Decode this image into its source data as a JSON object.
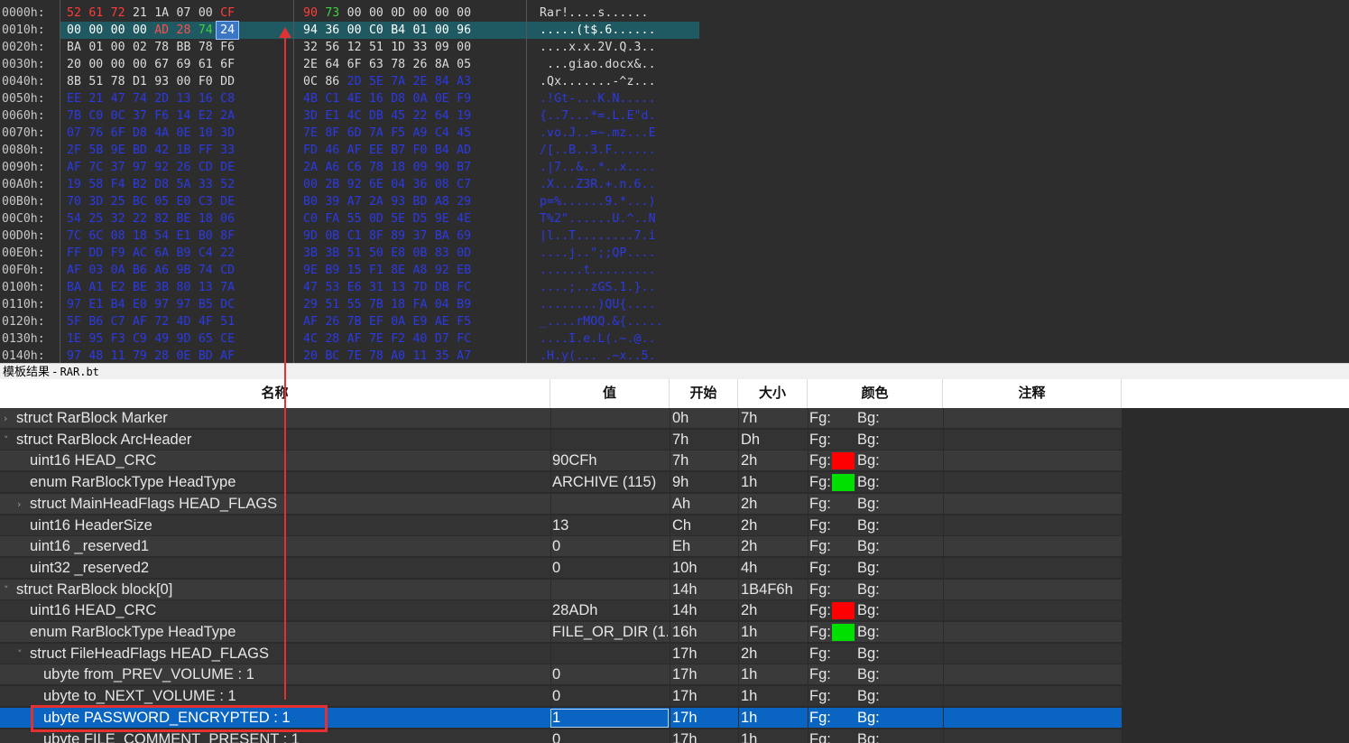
{
  "hex": {
    "rows": [
      {
        "addr": "0000h:",
        "bytes": [
          "52",
          "61",
          "72",
          "21",
          "1A",
          "07",
          "00",
          "CF",
          "90",
          "73",
          "00",
          "00",
          "0D",
          "00",
          "00",
          "00"
        ],
        "ascii": "Rar!....s......"
      },
      {
        "addr": "0010h:",
        "bytes": [
          "00",
          "00",
          "00",
          "00",
          "AD",
          "28",
          "74",
          "24",
          "94",
          "36",
          "00",
          "C0",
          "B4",
          "01",
          "00",
          "96"
        ],
        "ascii": ".....(t$.6......"
      },
      {
        "addr": "0020h:",
        "bytes": [
          "BA",
          "01",
          "00",
          "02",
          "78",
          "BB",
          "78",
          "F6",
          "32",
          "56",
          "12",
          "51",
          "1D",
          "33",
          "09",
          "00"
        ],
        "ascii": "....x.x.2V.Q.3.."
      },
      {
        "addr": "0030h:",
        "bytes": [
          "20",
          "00",
          "00",
          "00",
          "67",
          "69",
          "61",
          "6F",
          "2E",
          "64",
          "6F",
          "63",
          "78",
          "26",
          "8A",
          "05"
        ],
        "ascii": " ...giao.docx&.."
      },
      {
        "addr": "0040h:",
        "bytes": [
          "8B",
          "51",
          "78",
          "D1",
          "93",
          "00",
          "F0",
          "DD",
          "0C",
          "86",
          "2D",
          "5E",
          "7A",
          "2E",
          "84",
          "A3"
        ],
        "ascii": ".Qx.......-^z..."
      },
      {
        "addr": "0050h:",
        "bytes": [
          "EE",
          "21",
          "47",
          "74",
          "2D",
          "13",
          "16",
          "C8",
          "4B",
          "C1",
          "4E",
          "16",
          "D8",
          "0A",
          "0E",
          "F9"
        ],
        "ascii": ".!Gt-...K.N....."
      },
      {
        "addr": "0060h:",
        "bytes": [
          "7B",
          "C0",
          "0C",
          "37",
          "F6",
          "14",
          "E2",
          "2A",
          "3D",
          "E1",
          "4C",
          "DB",
          "45",
          "22",
          "64",
          "19"
        ],
        "ascii": "{..7...*=.L.E\"d."
      },
      {
        "addr": "0070h:",
        "bytes": [
          "07",
          "76",
          "6F",
          "D8",
          "4A",
          "0E",
          "10",
          "3D",
          "7E",
          "8F",
          "6D",
          "7A",
          "F5",
          "A9",
          "C4",
          "45"
        ],
        "ascii": ".vo.J..=~.mz...E"
      },
      {
        "addr": "0080h:",
        "bytes": [
          "2F",
          "5B",
          "9E",
          "BD",
          "42",
          "1B",
          "FF",
          "33",
          "FD",
          "46",
          "AF",
          "EE",
          "B7",
          "F0",
          "B4",
          "AD"
        ],
        "ascii": "/[..B..3.F......"
      },
      {
        "addr": "0090h:",
        "bytes": [
          "AF",
          "7C",
          "37",
          "97",
          "92",
          "26",
          "CD",
          "DE",
          "2A",
          "A6",
          "C6",
          "78",
          "18",
          "09",
          "90",
          "B7"
        ],
        "ascii": ".|7..&..*..x...."
      },
      {
        "addr": "00A0h:",
        "bytes": [
          "19",
          "58",
          "F4",
          "B2",
          "D8",
          "5A",
          "33",
          "52",
          "00",
          "2B",
          "92",
          "6E",
          "04",
          "36",
          "08",
          "C7"
        ],
        "ascii": ".X...Z3R.+.n.6.."
      },
      {
        "addr": "00B0h:",
        "bytes": [
          "70",
          "3D",
          "25",
          "BC",
          "05",
          "E0",
          "C3",
          "DE",
          "B0",
          "39",
          "A7",
          "2A",
          "93",
          "BD",
          "A8",
          "29"
        ],
        "ascii": "p=%......9.*...)"
      },
      {
        "addr": "00C0h:",
        "bytes": [
          "54",
          "25",
          "32",
          "22",
          "82",
          "BE",
          "18",
          "06",
          "C0",
          "FA",
          "55",
          "0D",
          "5E",
          "D5",
          "9E",
          "4E"
        ],
        "ascii": "T%2\"......U.^..N"
      },
      {
        "addr": "00D0h:",
        "bytes": [
          "7C",
          "6C",
          "08",
          "18",
          "54",
          "E1",
          "B0",
          "8F",
          "9D",
          "0B",
          "C1",
          "8F",
          "89",
          "37",
          "BA",
          "69"
        ],
        "ascii": "|l..T........7.i"
      },
      {
        "addr": "00E0h:",
        "bytes": [
          "FF",
          "DD",
          "F9",
          "AC",
          "6A",
          "B9",
          "C4",
          "22",
          "3B",
          "3B",
          "51",
          "50",
          "E8",
          "0B",
          "83",
          "0D"
        ],
        "ascii": "....j..\";;QP...."
      },
      {
        "addr": "00F0h:",
        "bytes": [
          "AF",
          "03",
          "0A",
          "B6",
          "A6",
          "9B",
          "74",
          "CD",
          "9E",
          "B9",
          "15",
          "F1",
          "8E",
          "A8",
          "92",
          "EB"
        ],
        "ascii": "......t........."
      },
      {
        "addr": "0100h:",
        "bytes": [
          "BA",
          "A1",
          "E2",
          "BE",
          "3B",
          "80",
          "13",
          "7A",
          "47",
          "53",
          "E6",
          "31",
          "13",
          "7D",
          "DB",
          "FC"
        ],
        "ascii": "....;..zGS.1.}.."
      },
      {
        "addr": "0110h:",
        "bytes": [
          "97",
          "E1",
          "B4",
          "E0",
          "97",
          "97",
          "B5",
          "DC",
          "29",
          "51",
          "55",
          "7B",
          "18",
          "FA",
          "04",
          "B9"
        ],
        "ascii": "........)QU{...."
      },
      {
        "addr": "0120h:",
        "bytes": [
          "5F",
          "B6",
          "C7",
          "AF",
          "72",
          "4D",
          "4F",
          "51",
          "AF",
          "26",
          "7B",
          "EF",
          "0A",
          "E9",
          "AE",
          "F5"
        ],
        "ascii": "_....rMOQ.&{....."
      },
      {
        "addr": "0130h:",
        "bytes": [
          "1E",
          "95",
          "F3",
          "C9",
          "49",
          "9D",
          "65",
          "CE",
          "4C",
          "28",
          "AF",
          "7E",
          "F2",
          "40",
          "D7",
          "FC"
        ],
        "ascii": "....I.e.L(.~.@.."
      },
      {
        "addr": "0140h:",
        "bytes": [
          "97",
          "48",
          "11",
          "79",
          "28",
          "0E",
          "BD",
          "AF",
          "20",
          "BC",
          "7E",
          "78",
          "A0",
          "11",
          "35",
          "A7"
        ],
        "ascii": ".H.y(... .~x..5."
      }
    ]
  },
  "template": {
    "title": "模板结果 - ",
    "file": "RAR.bt",
    "columns": [
      "名称",
      "值",
      "开始",
      "大小",
      "颜色",
      "注释"
    ],
    "rows": [
      {
        "indent": 0,
        "expander": ">",
        "name": "struct RarBlock Marker",
        "value": "",
        "start": "0h",
        "size": "7h",
        "fg": "Fg:",
        "bg": "Bg:",
        "fgColor": ""
      },
      {
        "indent": 0,
        "expander": "v",
        "name": "struct RarBlock ArcHeader",
        "value": "",
        "start": "7h",
        "size": "Dh",
        "fg": "Fg:",
        "bg": "Bg:",
        "fgColor": ""
      },
      {
        "indent": 1,
        "expander": "",
        "name": "uint16 HEAD_CRC",
        "value": "90CFh",
        "start": "7h",
        "size": "2h",
        "fg": "Fg:",
        "bg": "Bg:",
        "fgColor": "#ff0000"
      },
      {
        "indent": 1,
        "expander": "",
        "name": "enum RarBlockType HeadType",
        "value": "ARCHIVE (115)",
        "start": "9h",
        "size": "1h",
        "fg": "Fg:",
        "bg": "Bg:",
        "fgColor": "#00e000"
      },
      {
        "indent": 1,
        "expander": ">",
        "name": "struct MainHeadFlags HEAD_FLAGS",
        "value": "",
        "start": "Ah",
        "size": "2h",
        "fg": "Fg:",
        "bg": "Bg:",
        "fgColor": ""
      },
      {
        "indent": 1,
        "expander": "",
        "name": "uint16 HeaderSize",
        "value": "13",
        "start": "Ch",
        "size": "2h",
        "fg": "Fg:",
        "bg": "Bg:",
        "fgColor": ""
      },
      {
        "indent": 1,
        "expander": "",
        "name": "uint16 _reserved1",
        "value": "0",
        "start": "Eh",
        "size": "2h",
        "fg": "Fg:",
        "bg": "Bg:",
        "fgColor": ""
      },
      {
        "indent": 1,
        "expander": "",
        "name": "uint32 _reserved2",
        "value": "0",
        "start": "10h",
        "size": "4h",
        "fg": "Fg:",
        "bg": "Bg:",
        "fgColor": ""
      },
      {
        "indent": 0,
        "expander": "v",
        "name": "struct RarBlock block[0]",
        "value": "",
        "start": "14h",
        "size": "1B4F6h",
        "fg": "Fg:",
        "bg": "Bg:",
        "fgColor": ""
      },
      {
        "indent": 1,
        "expander": "",
        "name": "uint16 HEAD_CRC",
        "value": "28ADh",
        "start": "14h",
        "size": "2h",
        "fg": "Fg:",
        "bg": "Bg:",
        "fgColor": "#ff0000"
      },
      {
        "indent": 1,
        "expander": "",
        "name": "enum RarBlockType HeadType",
        "value": "FILE_OR_DIR (1...",
        "start": "16h",
        "size": "1h",
        "fg": "Fg:",
        "bg": "Bg:",
        "fgColor": "#00e000"
      },
      {
        "indent": 1,
        "expander": "v",
        "name": "struct FileHeadFlags HEAD_FLAGS",
        "value": "",
        "start": "17h",
        "size": "2h",
        "fg": "Fg:",
        "bg": "Bg:",
        "fgColor": ""
      },
      {
        "indent": 2,
        "expander": "",
        "name": "ubyte from_PREV_VOLUME : 1",
        "value": "0",
        "start": "17h",
        "size": "1h",
        "fg": "Fg:",
        "bg": "Bg:",
        "fgColor": ""
      },
      {
        "indent": 2,
        "expander": "",
        "name": "ubyte to_NEXT_VOLUME : 1",
        "value": "0",
        "start": "17h",
        "size": "1h",
        "fg": "Fg:",
        "bg": "Bg:",
        "fgColor": ""
      },
      {
        "indent": 2,
        "expander": "",
        "name": "ubyte PASSWORD_ENCRYPTED : 1",
        "value": "1",
        "start": "17h",
        "size": "1h",
        "fg": "Fg:",
        "bg": "Bg:",
        "fgColor": "",
        "selected": true
      },
      {
        "indent": 2,
        "expander": "",
        "name": "ubyte FILE_COMMENT_PRESENT : 1",
        "value": "0",
        "start": "17h",
        "size": "1h",
        "fg": "Fg:",
        "bg": "Bg:",
        "fgColor": ""
      }
    ]
  },
  "colors": {
    "hex_red": "#ff3b3b",
    "hex_green": "#3fcf3f",
    "hex_blue": "#2c39e6",
    "selection": "#0a64c2",
    "annotation": "#e53030"
  }
}
